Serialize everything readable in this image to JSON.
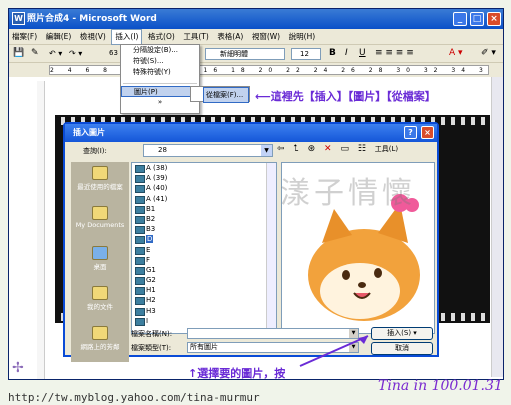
{
  "window": {
    "title": "照片合成4 - Microsoft Word"
  },
  "menubar": [
    "檔案(F)",
    "編輯(E)",
    "檢視(V)",
    "插入(I)",
    "格式(O)",
    "工具(T)",
    "表格(A)",
    "視窗(W)",
    "說明(H)"
  ],
  "toolbar": {
    "font_name": "新細明體",
    "font_size": "12",
    "zoom": "63"
  },
  "ruler": {
    "ticks": "2 4 6 8 10 12 14 16 18 20 22 24 26 28 30 32 34 36 38 40 42 44 46 48 50 52 54 56 58 60 62 64 66 68"
  },
  "insert_menu": {
    "items": [
      "分隔設定(B)...",
      "符號(S)...",
      "特殊符號(Y)",
      "圖片(P)"
    ],
    "more": "»",
    "submenu_item": "從檔案(F)..."
  },
  "annotation_top": "這裡先【插入】【圖片】【從檔案】",
  "dialog": {
    "title": "插入圖片",
    "look_in_label": "查詢(I):",
    "look_in_value": "28",
    "tools_label": "工具(L)",
    "places": [
      "最近使用的檔案",
      "My Documents",
      "桌面",
      "我的文件",
      "網路上的芳鄰"
    ],
    "files": [
      "A (38)",
      "A (39)",
      "A (40)",
      "A (41)",
      "B1",
      "B2",
      "B3",
      "D",
      "E",
      "F",
      "G1",
      "G2",
      "H1",
      "H2",
      "H3",
      "I"
    ],
    "selected_file": "D",
    "filename_label": "檔案名稱(N):",
    "filename_value": "",
    "filetype_label": "檔案類型(T):",
    "filetype_value": "所有圖片",
    "insert_button": "插入(S)",
    "cancel_button": "取消"
  },
  "annotation_bottom": "↑選擇要的圖片，按",
  "footer_url": "http://tw.myblog.yahoo.com/tina-murmur",
  "signature": "Tina in 100.01.31",
  "watermark": "漾子情懷"
}
